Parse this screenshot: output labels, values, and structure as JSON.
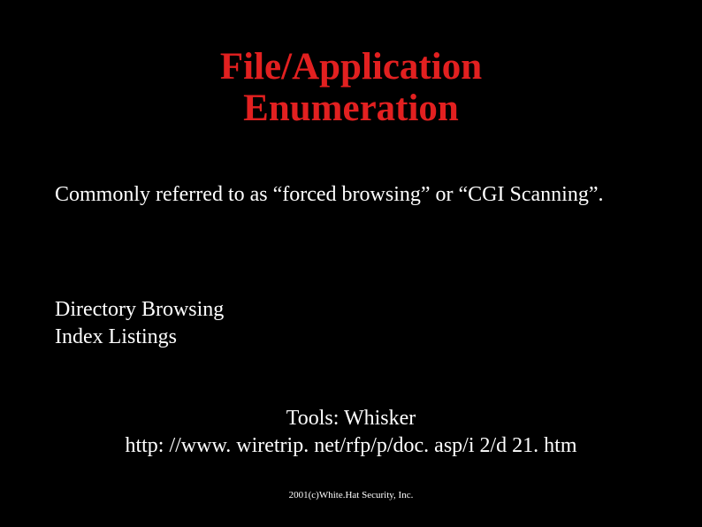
{
  "slide": {
    "title_line1": "File/Application",
    "title_line2": "Enumeration",
    "intro": "Commonly referred to as “forced browsing” or “CGI Scanning”.",
    "browsing_line1": "Directory Browsing",
    "browsing_line2": "Index Listings",
    "tools_label": "Tools: Whisker",
    "tools_url": "http: //www. wiretrip. net/rfp/p/doc. asp/i 2/d 21. htm",
    "footer": "2001(c)White.Hat Security, Inc."
  }
}
